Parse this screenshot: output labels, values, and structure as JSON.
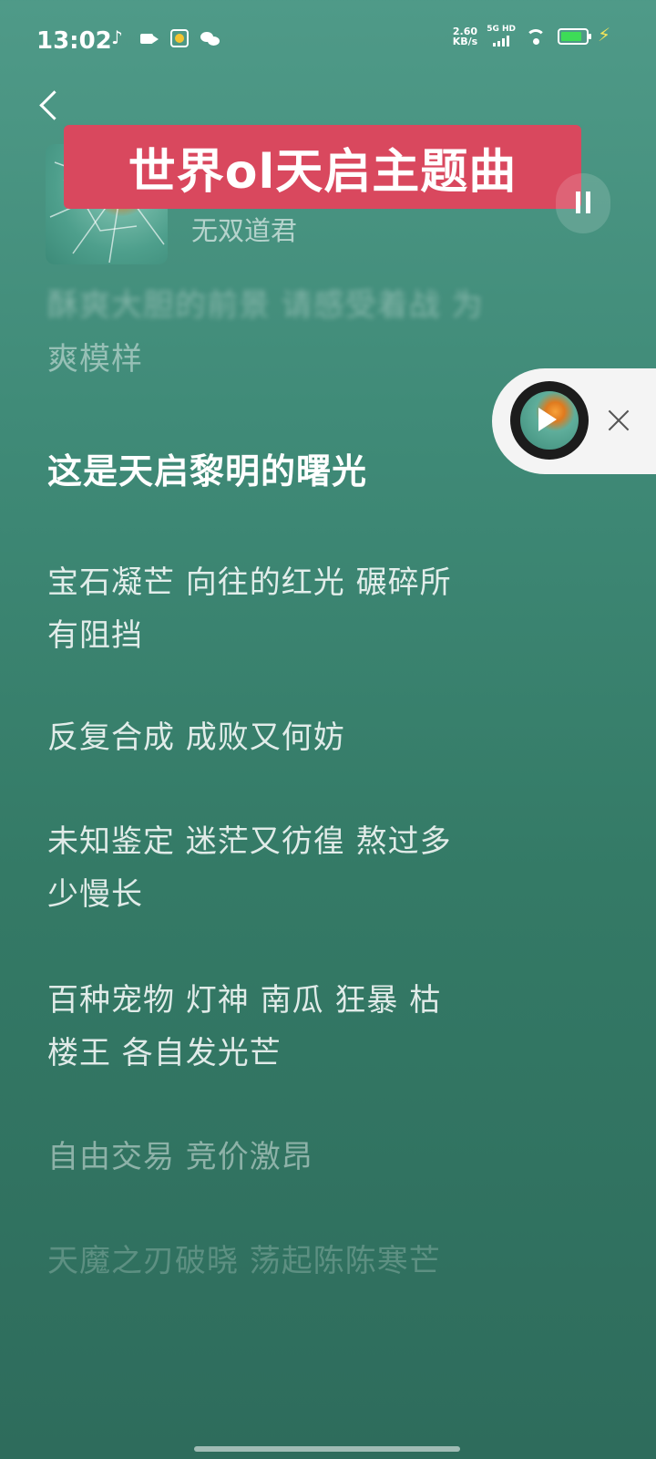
{
  "status_bar": {
    "time": "13:02",
    "net_speed_value": "2.60",
    "net_speed_unit": "KB/s",
    "signal_label": "5G HD",
    "battery_level": 0.85
  },
  "song": {
    "title_banner": "世界ol天启主题曲",
    "artist": "无双道君"
  },
  "lyrics": {
    "partial_blurred": "酥爽大胆的前景 请感受着战 为",
    "line_prev_end": "爽模样",
    "current": "这是天启黎明的曙光",
    "lines": [
      "宝石凝芒  向往的红光 碾碎所",
      "有阻挡",
      "反复合成 成败又何妨",
      "未知鉴定 迷茫又彷徨 熬过多",
      "少慢长",
      "百种宠物  灯神 南瓜 狂暴 枯",
      "楼王 各自发光芒",
      "自由交易 竞价激昂",
      "天魔之刃破晓 荡起陈陈寒芒"
    ]
  },
  "colors": {
    "background": "#3f8a77",
    "title_banner": "#d9485e",
    "battery_fill": "#3ddc57"
  },
  "icons": [
    "back-arrow-icon",
    "pause-icon",
    "play-icon",
    "close-icon",
    "wifi-icon",
    "battery-icon"
  ]
}
